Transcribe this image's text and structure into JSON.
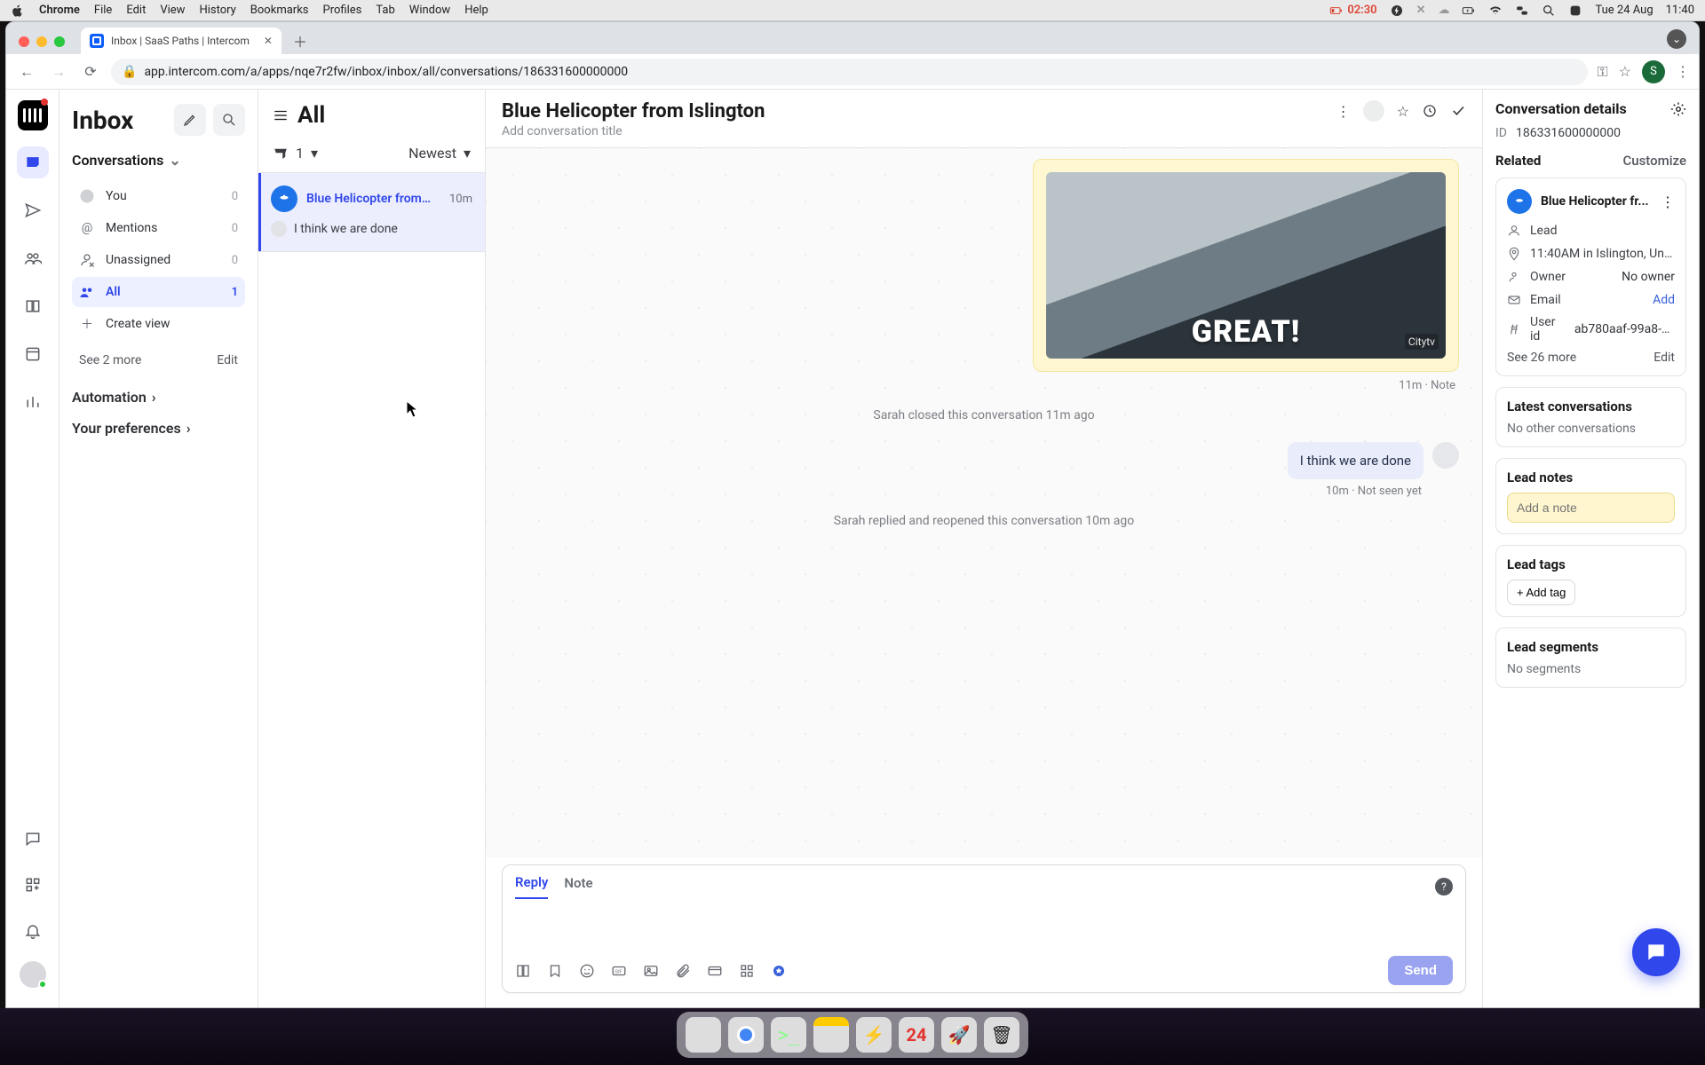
{
  "mac": {
    "app_name": "Chrome",
    "menus": [
      "File",
      "Edit",
      "View",
      "History",
      "Bookmarks",
      "Profiles",
      "Tab",
      "Window",
      "Help"
    ],
    "battery_time": "02:30",
    "date": "Tue 24 Aug",
    "clock": "11:40"
  },
  "chrome": {
    "tab_title": "Inbox | SaaS Paths | Intercom",
    "url": "app.intercom.com/a/apps/nqe7r2fw/inbox/inbox/all/conversations/186331600000000",
    "profile_initial": "S"
  },
  "sidebar": {
    "title": "Inbox",
    "section_conversations": "Conversations",
    "items": [
      {
        "label": "You",
        "count": "0"
      },
      {
        "label": "Mentions",
        "count": "0"
      },
      {
        "label": "Unassigned",
        "count": "0"
      },
      {
        "label": "All",
        "count": "1"
      }
    ],
    "create_view": "Create view",
    "see_more": "See 2 more",
    "edit": "Edit",
    "automation": "Automation",
    "prefs": "Your preferences"
  },
  "list": {
    "title": "All",
    "open_count": "1",
    "sort": "Newest",
    "item": {
      "name": "Blue Helicopter from…",
      "time": "10m",
      "preview": "I think we are done"
    }
  },
  "thread": {
    "title": "Blue Helicopter from Islington",
    "subtitle": "Add conversation title",
    "note_image_caption": "GREAT!",
    "note_image_brand": "Citytv",
    "note_meta": "11m · Note",
    "system_closed": "Sarah closed this conversation 11m ago",
    "bubble": "I think we are done",
    "bubble_meta": "10m · Not seen yet",
    "system_reopened": "Sarah replied and reopened this conversation 10m ago",
    "composer": {
      "tab_reply": "Reply",
      "tab_note": "Note",
      "send": "Send"
    }
  },
  "details": {
    "title": "Conversation details",
    "id_label": "ID",
    "id_value": "186331600000000",
    "related": "Related",
    "customize": "Customize",
    "entity_name": "Blue Helicopter fr...",
    "lead": "Lead",
    "time_loc": "11:40AM in Islington, United …",
    "owner_label": "Owner",
    "owner_value": "No owner",
    "email_label": "Email",
    "email_add": "Add",
    "userid_label": "User id",
    "userid_value": "ab780aaf-99a8-4c…",
    "see_more": "See 26 more",
    "edit": "Edit",
    "latest_title": "Latest conversations",
    "latest_empty": "No other conversations",
    "notes_title": "Lead notes",
    "notes_placeholder": "Add a note",
    "tags_title": "Lead tags",
    "tags_add": "+ Add tag",
    "segments_title": "Lead segments",
    "segments_empty": "No segments"
  },
  "dock": {
    "cal_day": "24"
  }
}
